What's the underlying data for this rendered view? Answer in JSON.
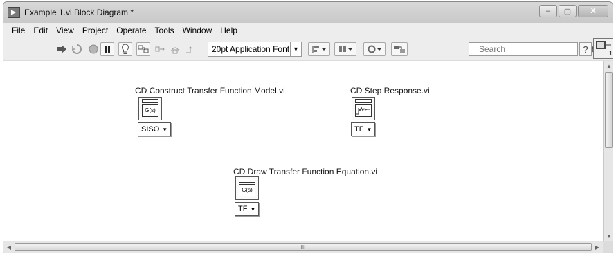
{
  "window": {
    "title": "Example 1.vi Block Diagram *",
    "minimize_glyph": "‒",
    "maximize_glyph": "▢",
    "close_glyph": "X"
  },
  "menu": [
    "File",
    "Edit",
    "View",
    "Project",
    "Operate",
    "Tools",
    "Window",
    "Help"
  ],
  "toolbar": {
    "font": "20pt Application Font",
    "search_placeholder": "Search",
    "help_glyph": "?",
    "vi_icon_number": "1"
  },
  "nodes": [
    {
      "label": "CD Construct Transfer Function Model.vi",
      "icon_text": "G(s)",
      "ring": "SISO"
    },
    {
      "label": "CD Step Response.vi",
      "icon_text": "",
      "ring": "TF"
    },
    {
      "label": "CD Draw Transfer Function Equation.vi",
      "icon_text": "G(s)",
      "ring": "TF"
    }
  ],
  "hscroll_grip": "III"
}
